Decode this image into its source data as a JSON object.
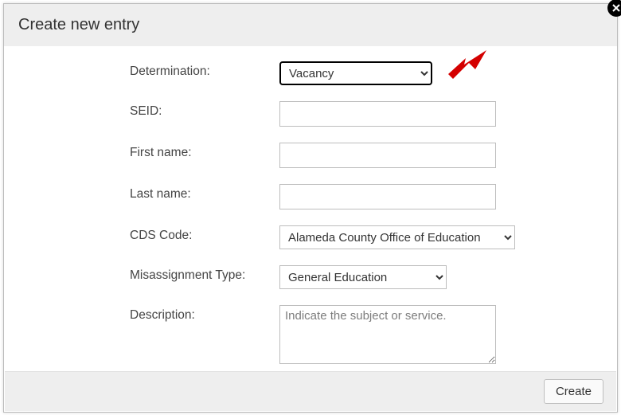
{
  "dialog": {
    "title": "Create new entry"
  },
  "fields": {
    "determination": {
      "label": "Determination:",
      "value": "Vacancy"
    },
    "seid": {
      "label": "SEID:",
      "value": ""
    },
    "first_name": {
      "label": "First name:",
      "value": ""
    },
    "last_name": {
      "label": "Last name:",
      "value": ""
    },
    "cds_code": {
      "label": "CDS Code:",
      "value": "Alameda County Office of Education"
    },
    "misassignment": {
      "label": "Misassignment Type:",
      "value": "General Education"
    },
    "description": {
      "label": "Description:",
      "placeholder": "Indicate the subject or service.",
      "value": ""
    }
  },
  "footer": {
    "create_label": "Create"
  },
  "annotation": {
    "arrow_color": "#d40000"
  }
}
